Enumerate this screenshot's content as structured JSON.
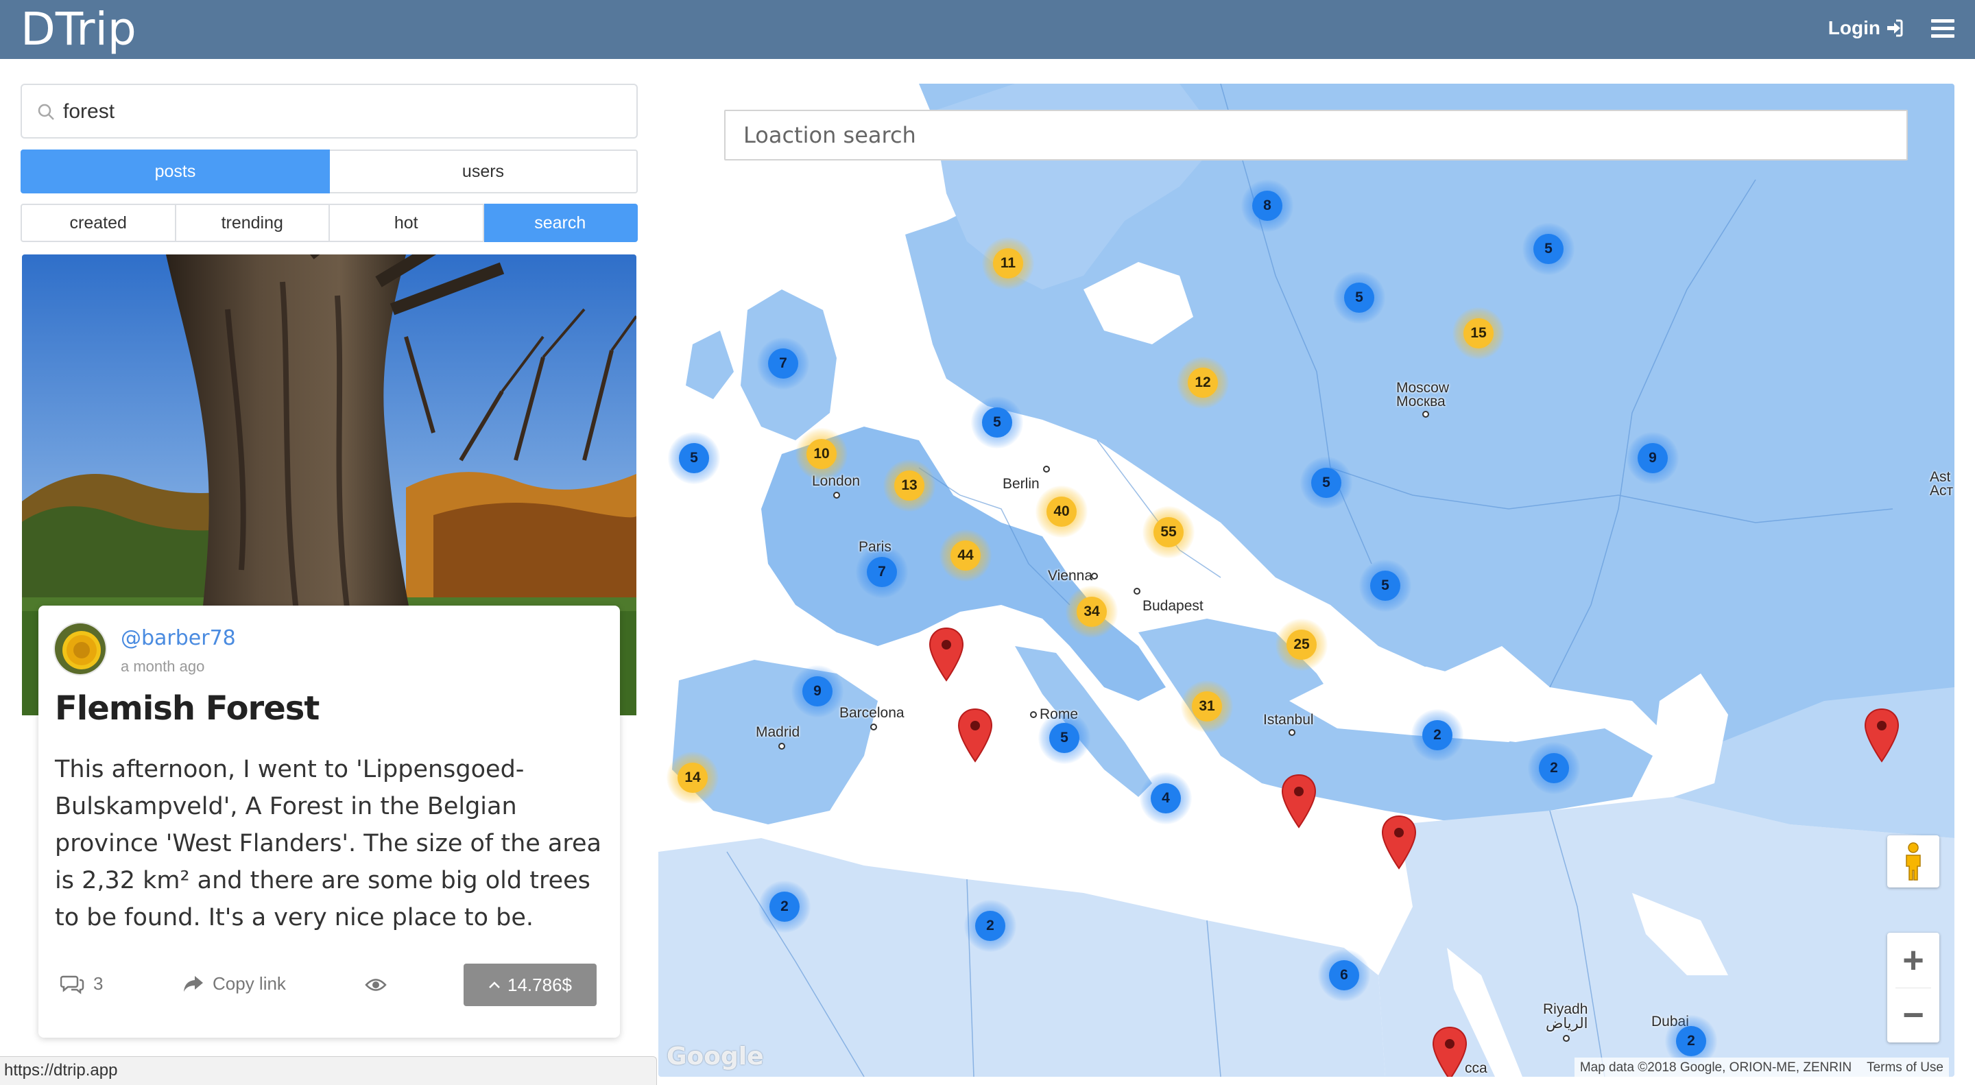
{
  "brand": "DTrip",
  "nav": {
    "login_label": "Login"
  },
  "search": {
    "query": "forest"
  },
  "tabs_main": [
    {
      "label": "posts",
      "active": true
    },
    {
      "label": "users",
      "active": false
    }
  ],
  "tabs_sort": [
    {
      "label": "created",
      "active": false
    },
    {
      "label": "trending",
      "active": false
    },
    {
      "label": "hot",
      "active": false
    },
    {
      "label": "search",
      "active": true
    }
  ],
  "post": {
    "author": "@barber78",
    "time": "a month ago",
    "title": "Flemish Forest",
    "body": "This afternoon, I went to 'Lippensgoed-Bulskampveld', A Forest in the Belgian province 'West Flanders'. The size of the area is 2,32 km² and there are some big old trees to be found. It's a very nice place to be.",
    "comments": "3",
    "copy_link_label": "Copy link",
    "payout": "14.786$"
  },
  "map": {
    "search_placeholder": "Loaction search",
    "google_logo": "Google",
    "attribution": "Map data ©2018 Google, ORION-ME, ZENRIN",
    "terms": "Terms of Use",
    "zoom_in": "+",
    "zoom_out": "−",
    "colors": {
      "cluster_blue": "#1f7fef",
      "cluster_yellow": "#f9c02c",
      "pin_red": "#e53935",
      "water": "#ffffff",
      "land": "#9cc6f2"
    },
    "clusters": [
      {
        "count": "8",
        "color": "blue"
      },
      {
        "count": "5",
        "color": "blue"
      },
      {
        "count": "11",
        "color": "yellow"
      },
      {
        "count": "5",
        "color": "blue"
      },
      {
        "count": "15",
        "color": "yellow"
      },
      {
        "count": "7",
        "color": "blue"
      },
      {
        "count": "12",
        "color": "yellow"
      },
      {
        "count": "5",
        "color": "blue"
      },
      {
        "count": "5",
        "color": "blue"
      },
      {
        "count": "10",
        "color": "yellow"
      },
      {
        "count": "13",
        "color": "yellow"
      },
      {
        "count": "9",
        "color": "blue"
      },
      {
        "count": "40",
        "color": "yellow"
      },
      {
        "count": "5",
        "color": "blue"
      },
      {
        "count": "55",
        "color": "yellow"
      },
      {
        "count": "44",
        "color": "yellow"
      },
      {
        "count": "7",
        "color": "blue"
      },
      {
        "count": "5",
        "color": "blue"
      },
      {
        "count": "34",
        "color": "yellow"
      },
      {
        "count": "25",
        "color": "yellow"
      },
      {
        "count": "9",
        "color": "blue"
      },
      {
        "count": "31",
        "color": "yellow"
      },
      {
        "count": "2",
        "color": "blue"
      },
      {
        "count": "5",
        "color": "blue"
      },
      {
        "count": "14",
        "color": "yellow"
      },
      {
        "count": "2",
        "color": "blue"
      },
      {
        "count": "4",
        "color": "blue"
      },
      {
        "count": "2",
        "color": "blue"
      },
      {
        "count": "2",
        "color": "blue"
      },
      {
        "count": "6",
        "color": "blue"
      },
      {
        "count": "2",
        "color": "blue"
      }
    ],
    "cities": [
      "Moscow",
      "Москва",
      "London",
      "Berlin",
      "Paris",
      "Vienna",
      "Budapest",
      "Barcelona",
      "Madrid",
      "Rome",
      "Istanbul",
      "Riyadh",
      "الرياض",
      "Dubai",
      "Ast",
      "Аст",
      "cca"
    ]
  },
  "status_url": "https://dtrip.app"
}
